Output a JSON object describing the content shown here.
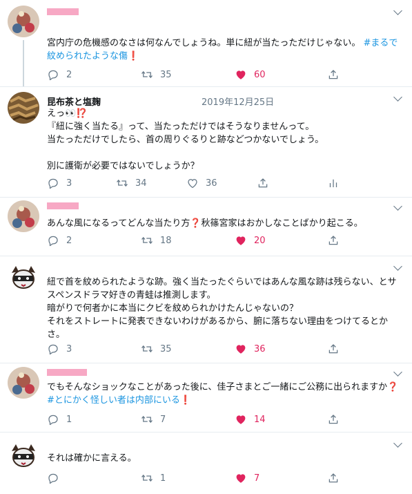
{
  "tweets": [
    {
      "text_parts": [
        "宮内庁の危機感のなさは何なんでしょうね。単に紐が当たっただけじゃない。 ",
        "#まるで紋められたような傷",
        "❗"
      ],
      "replies": "2",
      "retweets": "35",
      "likes": "60",
      "liked": true
    },
    {
      "name": "昆布茶と塩麹",
      "date": "2019年12月25日",
      "text": "えっ👀⁉️\n『紐に強く当たる』って、当たっただけではそうなりませんって。\n当たっただけでしたら、首の周りぐるりと跡などつかないでしょう。\n\n別に護衛が必要ではないでしょうか？",
      "replies": "3",
      "retweets": "34",
      "likes": "36",
      "liked": false
    },
    {
      "text_parts": [
        "あんな風になるってどんな当たり方",
        "❓",
        "秋篠宮家はおかしなことばかり起こる。"
      ],
      "replies": "2",
      "retweets": "18",
      "likes": "20",
      "liked": true
    },
    {
      "text": "紐で首を紋められたような跡。強く当たったぐらいではあんな風な跡は残らない、とサスペンスドラマ好きの青蛙は推測します。\n暗がりで何者かに本当にクビを紋められかけたんじゃないの？\nそれをストレートに発表できないわけがあるから、腑に落ちない理由をつけてるとかさ。",
      "replies": "3",
      "retweets": "35",
      "likes": "36",
      "liked": true
    },
    {
      "text_parts": [
        "でもそんなショックなことがあった後に、佳子さまとご一緒にご公務に出られますか",
        "❓",
        " ",
        "#とにかく怪しい者は内部にいる",
        "❗"
      ],
      "replies": "1",
      "retweets": "7",
      "likes": "14",
      "liked": true
    },
    {
      "text": "それは確かに言える。",
      "replies": "",
      "retweets": "1",
      "likes": "7",
      "liked": true
    }
  ],
  "colors": {
    "like": "#e0245e",
    "hashtag": "#1b95e0",
    "icon": "#657786",
    "redaction": "#f7a8c4"
  },
  "icons": [
    "reply-icon",
    "retweet-icon",
    "like-heart-icon",
    "share-icon",
    "analytics-icon",
    "chevron-down-icon"
  ]
}
